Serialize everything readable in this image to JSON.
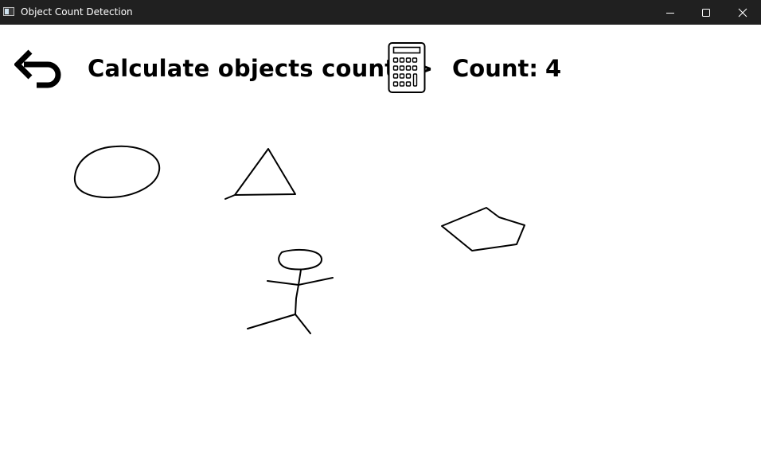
{
  "window": {
    "title": "Object Count Detection",
    "controls": [
      "minimize",
      "maximize",
      "close"
    ]
  },
  "toolbar": {
    "undo_icon": "undo-arrow-icon",
    "prompt": "Calculate objects count ->",
    "calc_icon": "calculator-icon",
    "count_label": "Count:",
    "count_value": "4"
  },
  "canvas": {
    "background": "#ffffff",
    "stroke_color": "#000000",
    "drawings": [
      "ellipse",
      "triangle",
      "pentagon",
      "stick-figure"
    ]
  }
}
